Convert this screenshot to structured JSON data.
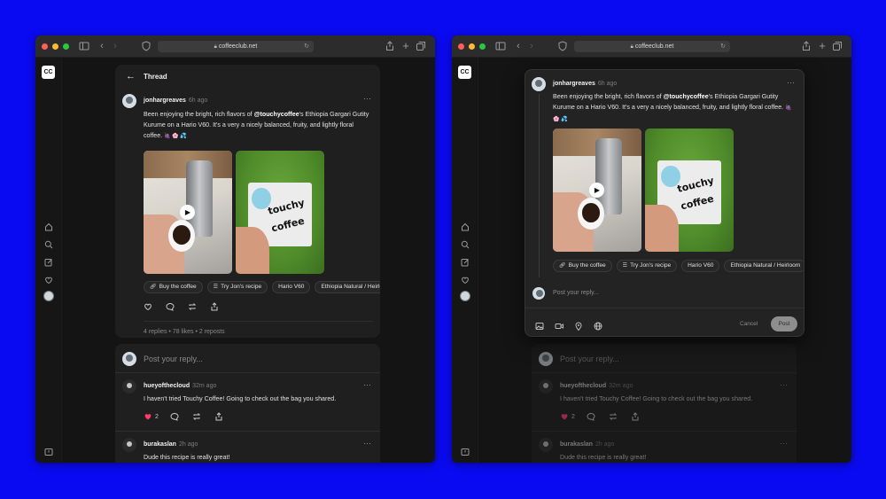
{
  "browser": {
    "url": "coffeeclub.net"
  },
  "app": {
    "logo": "CC"
  },
  "thread": {
    "back_label": "←",
    "title": "Thread"
  },
  "post": {
    "author": "jonhargreaves",
    "time": "6h ago",
    "text_before": "Been enjoying the bright, rich flavors of ",
    "mention": "@touchycoffee",
    "text_after": "'s Ethiopia Gargari Gutity Kurume on a Hario V60. It's a very a nicely balanced, fruity, and lightly floral coffee.",
    "emojis": "🍇 🌸 💦",
    "bag_text_1": "touchy",
    "bag_text_2": "coffee",
    "chips": [
      {
        "icon": "link-icon",
        "label": "Buy the coffee"
      },
      {
        "icon": "list-icon",
        "label": "Try Jon's recipe"
      },
      {
        "icon": "",
        "label": "Hario V60"
      },
      {
        "icon": "",
        "label": "Ethiopia Natural / Heirloom"
      }
    ],
    "stats": "4 replies • 78 likes • 2 reposts"
  },
  "composer": {
    "placeholder": "Post your reply...",
    "modal_placeholder": "Post your reply...",
    "cancel_label": "Cancel",
    "post_label": "Post"
  },
  "replies": [
    {
      "author": "hueyofthecloud",
      "time": "32m ago",
      "text": "I haven't tried Touchy Coffee! Going to check out the bag you shared.",
      "likes": "2"
    },
    {
      "author": "burakaslan",
      "time": "2h ago",
      "text": "Dude this recipe is really great!"
    }
  ],
  "colors": {
    "background": "#0a0af2",
    "like": "#ff3b6b",
    "panel": "#1f1f1f"
  }
}
